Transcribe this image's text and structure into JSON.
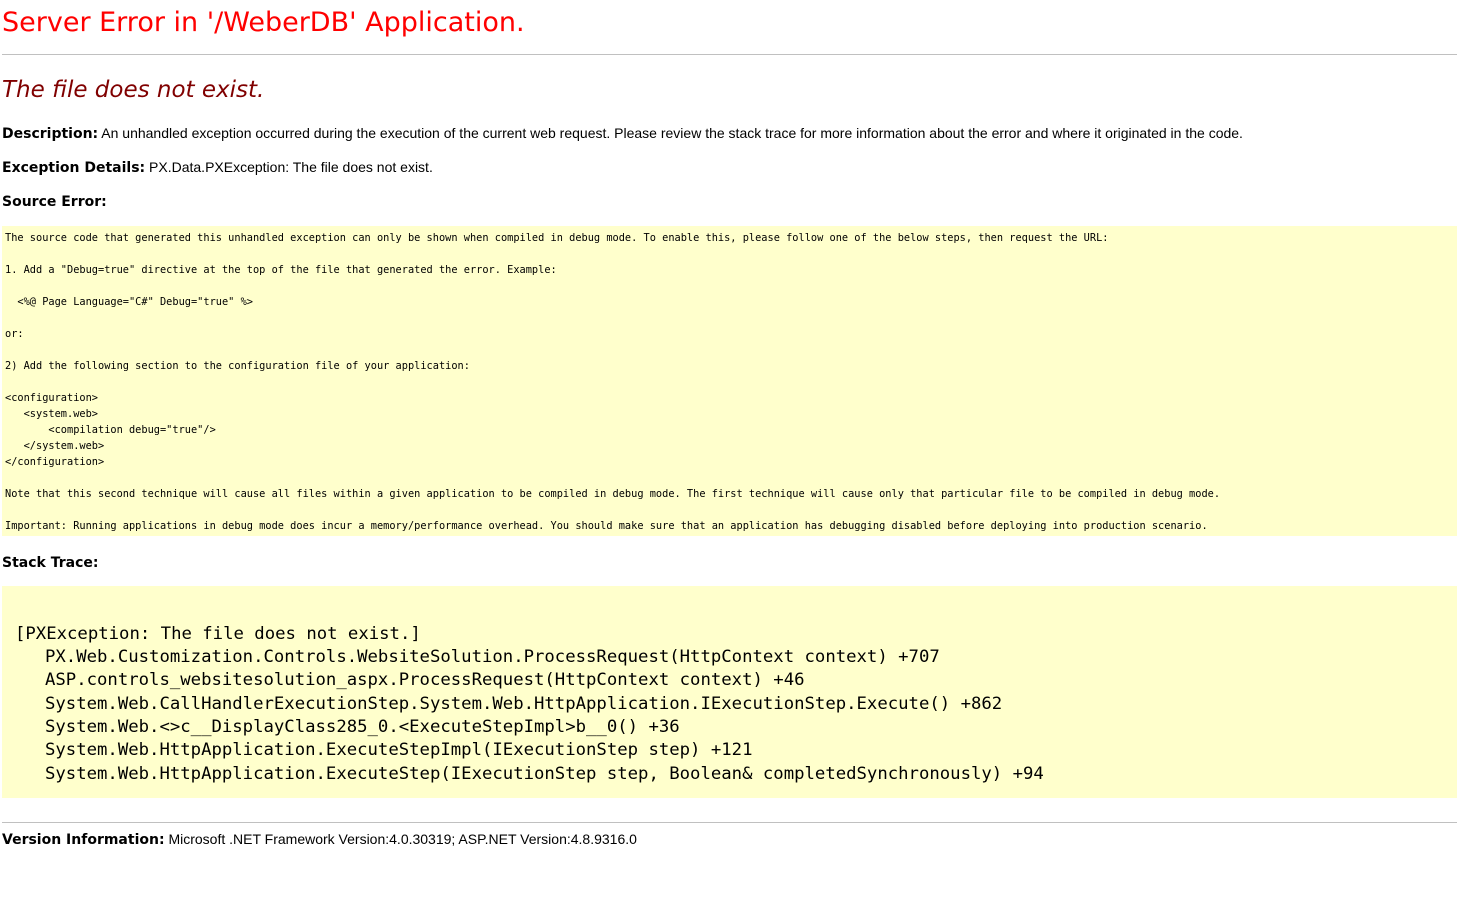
{
  "page": {
    "title": "Server Error in '/WeberDB' Application.",
    "subtitle": "The file does not exist."
  },
  "description": {
    "label": "Description:",
    "text": " An unhandled exception occurred during the execution of the current web request. Please review the stack trace for more information about the error and where it originated in the code."
  },
  "exception": {
    "label": "Exception Details:",
    "text": " PX.Data.PXException: The file does not exist."
  },
  "source_error": {
    "label": "Source Error:",
    "lines": [
      "The source code that generated this unhandled exception can only be shown when compiled in debug mode. To enable this, please follow one of the below steps, then request the URL:",
      "1. Add a \"Debug=true\" directive at the top of the file that generated the error. Example:",
      "  <%@ Page Language=\"C#\" Debug=\"true\" %>",
      "or:",
      "2) Add the following section to the configuration file of your application:",
      "<configuration>",
      "   <system.web>",
      "       <compilation debug=\"true\"/>",
      "   </system.web>",
      "</configuration>",
      "Note that this second technique will cause all files within a given application to be compiled in debug mode. The first technique will cause only that particular file to be compiled in debug mode.",
      "Important: Running applications in debug mode does incur a memory/performance overhead. You should make sure that an application has debugging disabled before deploying into production scenario."
    ]
  },
  "stack_trace": {
    "label": "Stack Trace:",
    "lines": [
      "[PXException: The file does not exist.]",
      "PX.Web.Customization.Controls.WebsiteSolution.ProcessRequest(HttpContext context) +707",
      "ASP.controls_websitesolution_aspx.ProcessRequest(HttpContext context) +46",
      "System.Web.CallHandlerExecutionStep.System.Web.HttpApplication.IExecutionStep.Execute() +862",
      "System.Web.<>c__DisplayClass285_0.<ExecuteStepImpl>b__0() +36",
      "System.Web.HttpApplication.ExecuteStepImpl(IExecutionStep step) +121",
      "System.Web.HttpApplication.ExecuteStep(IExecutionStep step, Boolean& completedSynchronously) +94"
    ]
  },
  "version": {
    "label": "Version Information:",
    "text": " Microsoft .NET Framework Version:4.0.30319; ASP.NET Version:4.8.9316.0"
  },
  "colors": {
    "title": "#ff0000",
    "subtitle": "#800000",
    "code_background": "#ffffcc",
    "rule": "#c0c0c0"
  }
}
